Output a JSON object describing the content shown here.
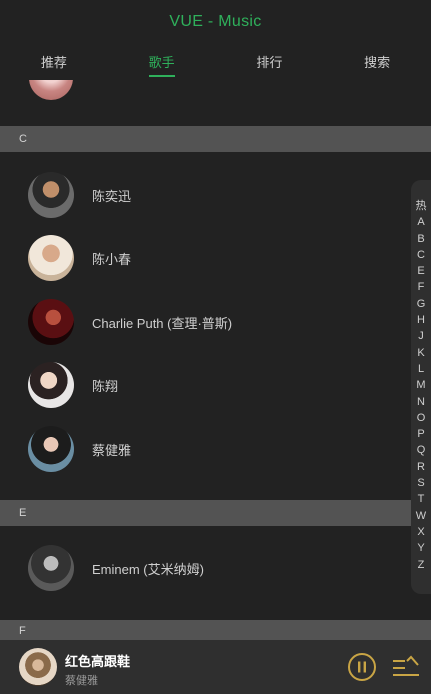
{
  "header": {
    "title": "VUE - Music"
  },
  "tabs": [
    {
      "label": "推荐",
      "active": false
    },
    {
      "label": "歌手",
      "active": true
    },
    {
      "label": "排行",
      "active": false
    },
    {
      "label": "搜索",
      "active": false
    }
  ],
  "groups": [
    {
      "letter": "C",
      "singers": [
        "陈奕迅",
        "陈小春",
        "Charlie Puth (查理·普斯)",
        "陈翔",
        "蔡健雅"
      ]
    },
    {
      "letter": "E",
      "singers": [
        "Eminem (艾米纳姆)"
      ]
    }
  ],
  "fixed_title": "F",
  "shortcut": [
    "热",
    "A",
    "B",
    "C",
    "E",
    "F",
    "G",
    "H",
    "J",
    "K",
    "L",
    "M",
    "N",
    "O",
    "P",
    "Q",
    "R",
    "S",
    "T",
    "W",
    "X",
    "Y",
    "Z"
  ],
  "mini_player": {
    "song": "红色高跟鞋",
    "singer": "蔡健雅"
  },
  "colors": {
    "accent": "#2fb05b",
    "player_icon": "#c9a545",
    "background": "#222222",
    "group_header": "#535353"
  }
}
